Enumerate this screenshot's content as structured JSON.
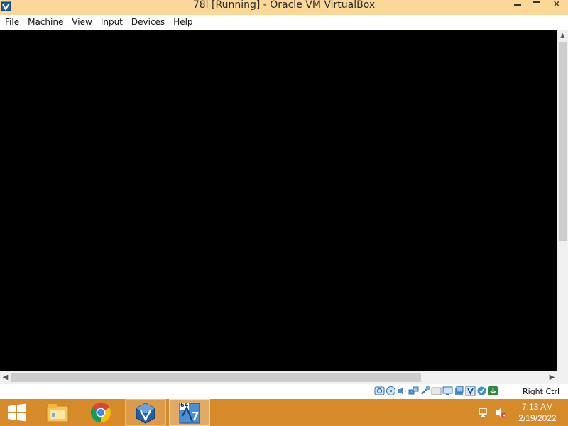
{
  "window": {
    "title": "78l [Running] - Oracle VM VirtualBox",
    "close_glyph": "✕"
  },
  "menu": [
    "File",
    "Machine",
    "View",
    "Input",
    "Devices",
    "Help"
  ],
  "status_bar": {
    "icons": [
      "hard-disk-icon",
      "optical-drive-icon",
      "audio-icon",
      "network-icon",
      "usb-icon",
      "shared-folders-icon",
      "display-icon",
      "video-capture-icon",
      "virtualization-icon",
      "cpu-icon",
      "mouse-integration-icon"
    ],
    "host_key": "Right Ctrl"
  },
  "taskbar": {
    "items": [
      "file-explorer-icon",
      "chrome-icon",
      "virtualbox-manager-icon",
      "windows7-vm-icon"
    ],
    "vm_badge": "64",
    "vm_number": "7",
    "accent": "#d68a2a"
  },
  "clock": {
    "time": "7:13 AM",
    "date": "2/19/2022"
  }
}
